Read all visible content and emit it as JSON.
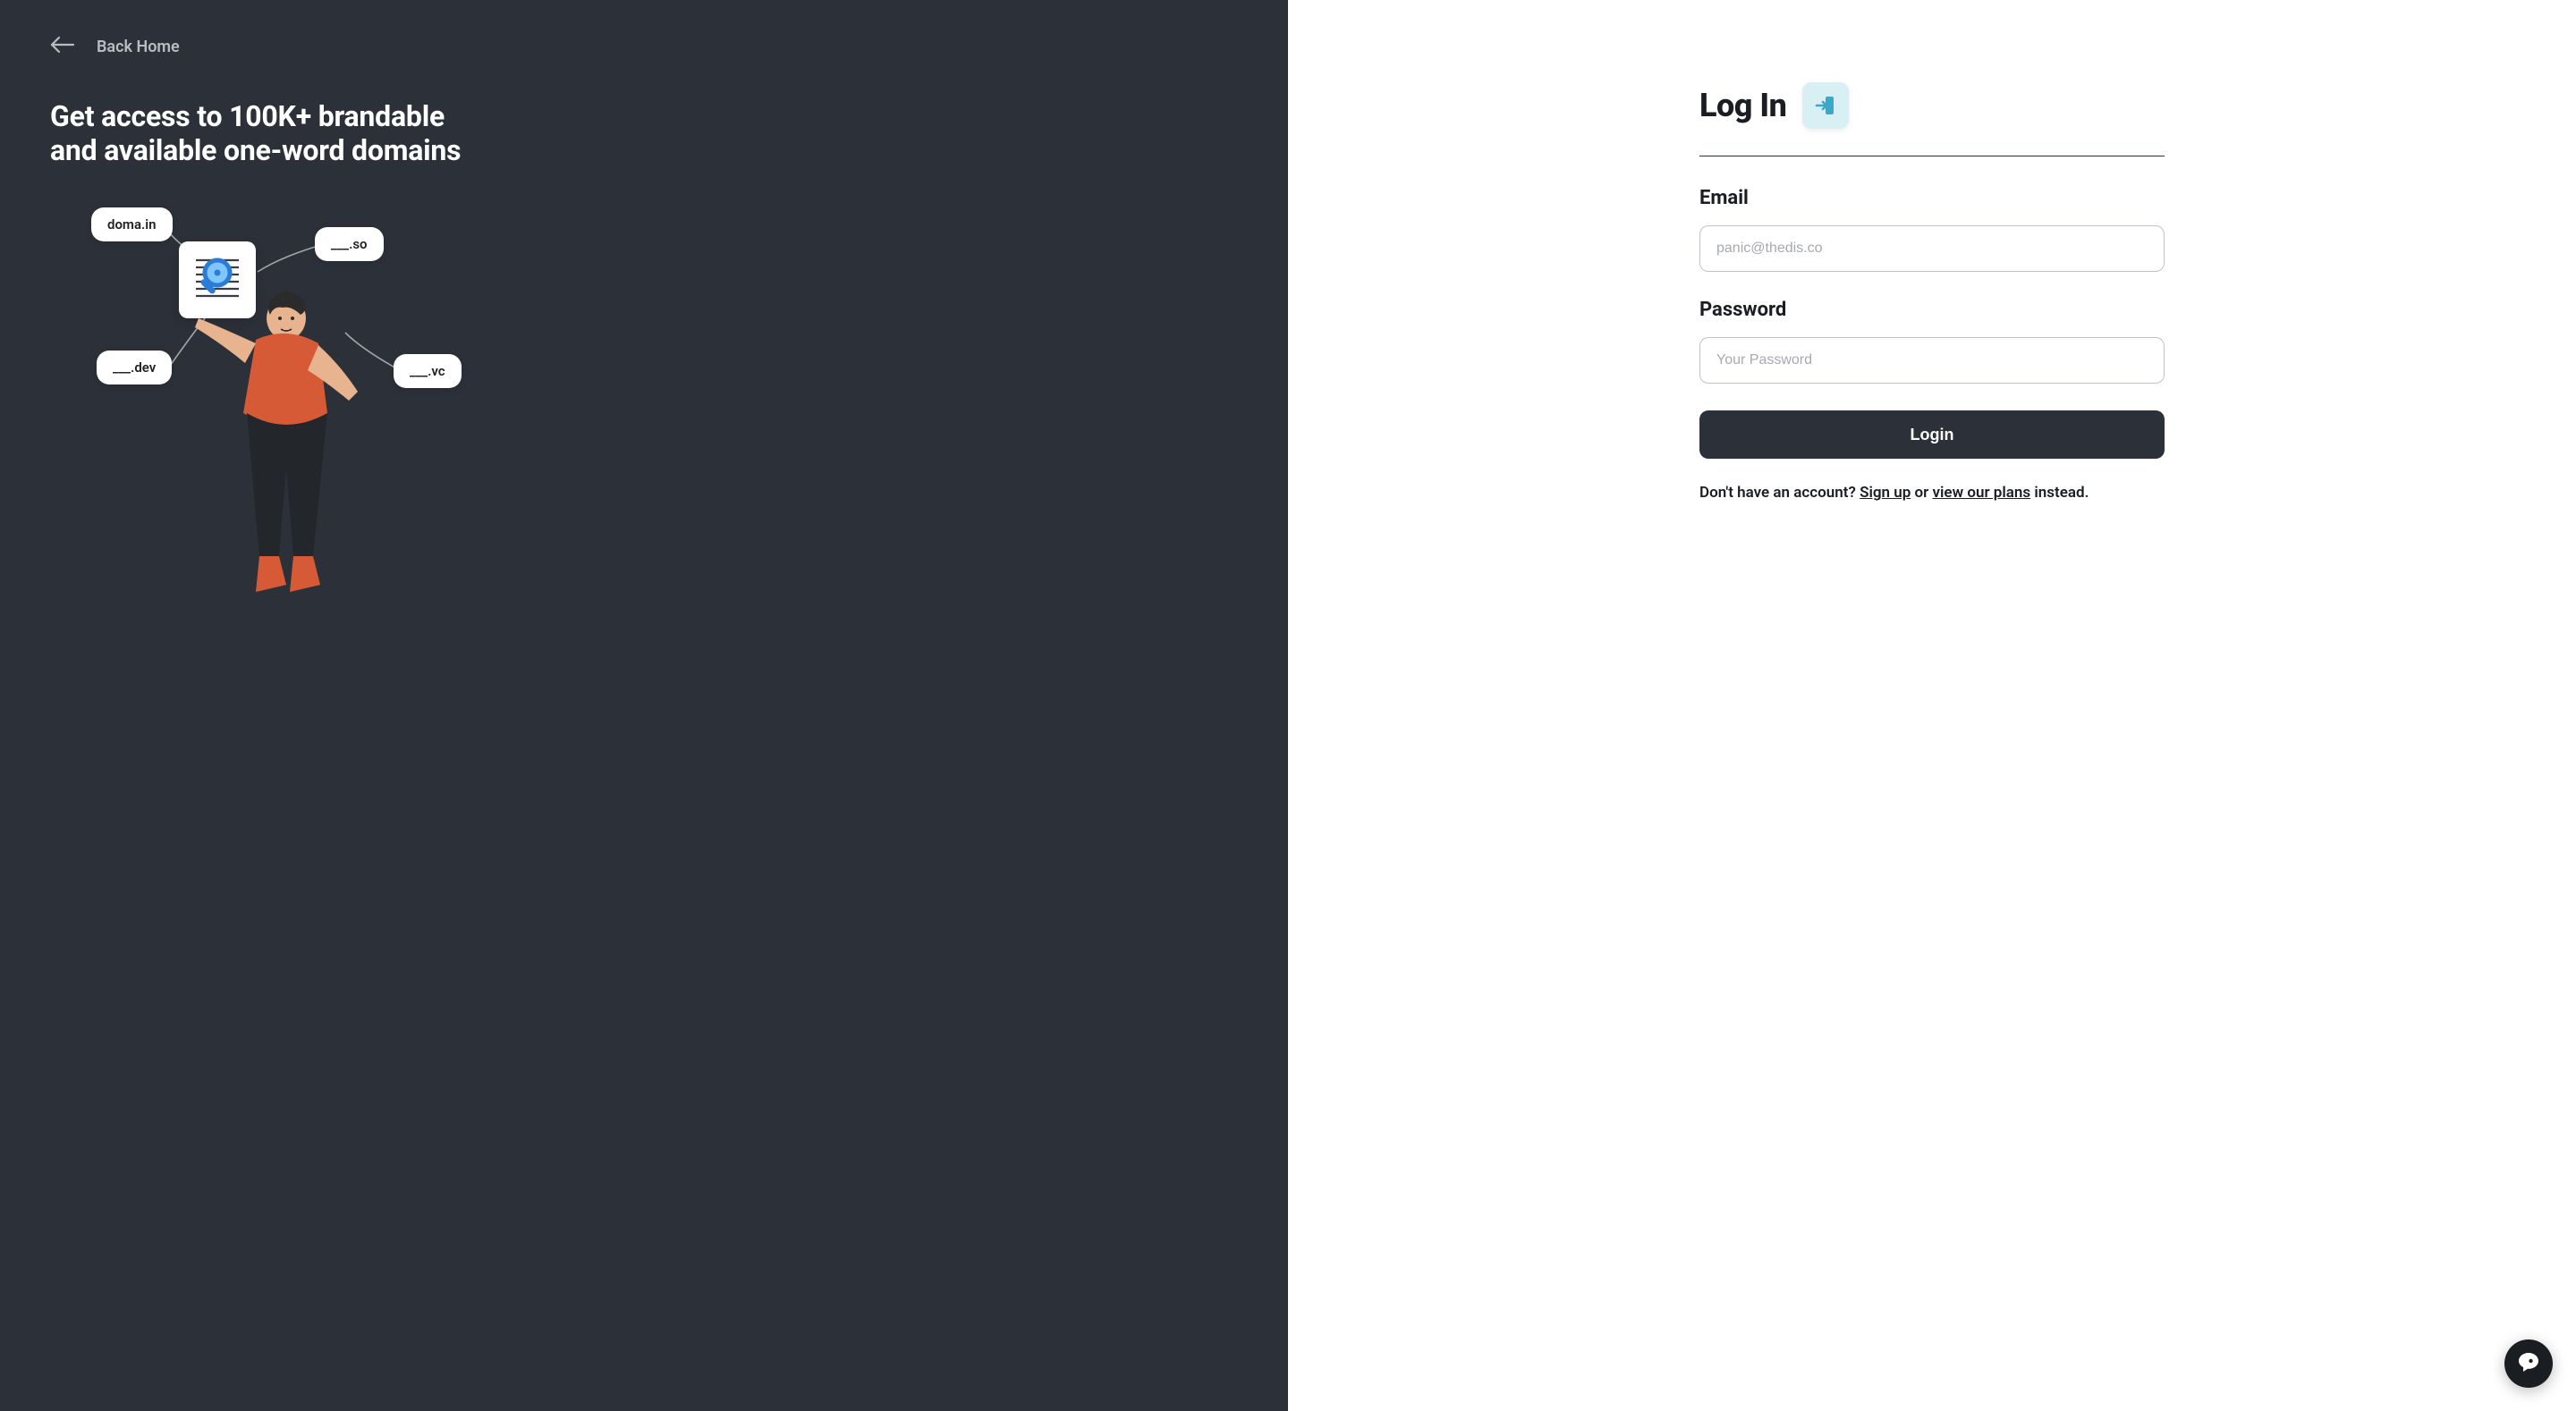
{
  "left": {
    "back_label": "Back Home",
    "tagline": "Get access to 100K+ brandable and available one-word domains",
    "bubbles": {
      "doma": "doma.in",
      "so": "___.so",
      "dev": "___.dev",
      "vc": "___.vc"
    }
  },
  "form": {
    "title": "Log In",
    "email_label": "Email",
    "email_placeholder": "panic@thedis.co",
    "email_value": "",
    "password_label": "Password",
    "password_placeholder": "Your Password",
    "password_value": "",
    "submit_label": "Login",
    "footer_prefix": "Don't have an account? ",
    "signup_label": "Sign up",
    "footer_middle": " or ",
    "plans_label": "view our plans",
    "footer_suffix": " instead."
  }
}
